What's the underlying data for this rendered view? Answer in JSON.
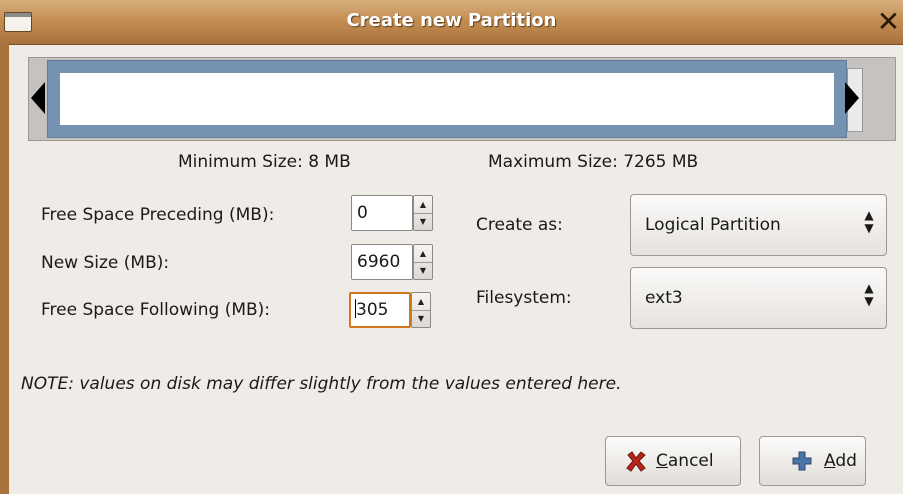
{
  "window": {
    "title": "Create new Partition",
    "close_glyph": "✕"
  },
  "graph": {
    "colors": {
      "partition_border": "#7592b0",
      "partition_fill": "#ffffff",
      "unallocated": "#c6c2bf"
    }
  },
  "sizes": {
    "minimum": "Minimum Size: 8 MB",
    "maximum": "Maximum Size: 7265 MB"
  },
  "fields": {
    "free_preceding": {
      "label": "Free Space Preceding (MB):",
      "value": "0"
    },
    "new_size": {
      "label": "New Size (MB):",
      "value": "6960"
    },
    "free_following": {
      "label": "Free Space Following (MB):",
      "value": "305"
    }
  },
  "create_as": {
    "label": "Create as:",
    "value": "Logical Partition"
  },
  "filesystem": {
    "label": "Filesystem:",
    "value": "ext3"
  },
  "note": "NOTE: values on disk may differ slightly from the values entered here.",
  "buttons": {
    "cancel": {
      "mnemonic": "C",
      "rest": "ancel",
      "icon": "cancel-x-icon"
    },
    "add": {
      "mnemonic": "A",
      "rest": "dd",
      "icon": "plus-icon"
    }
  },
  "colors": {
    "titlebar": "#c48e53",
    "focus_ring": "#d0781f",
    "cancel_icon": "#b8261a",
    "add_icon": "#4c72a6"
  }
}
